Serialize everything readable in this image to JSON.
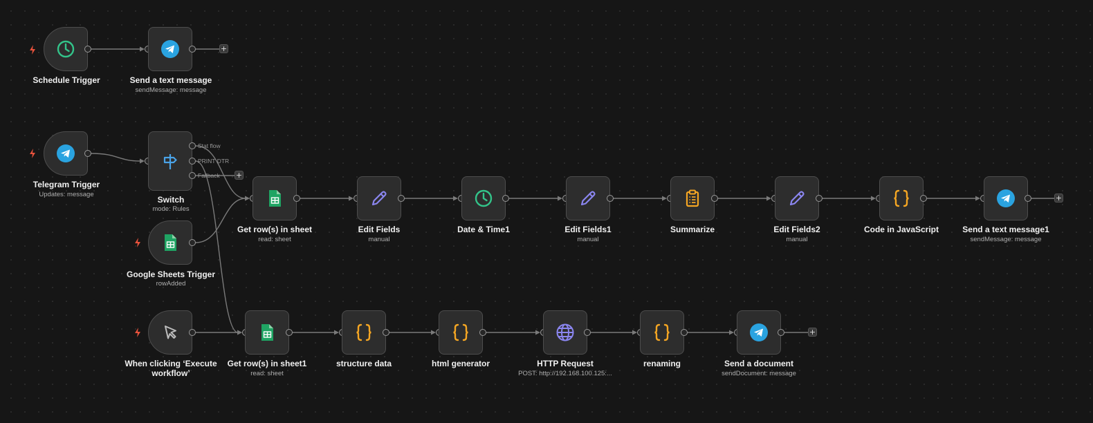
{
  "nodes": [
    {
      "id": "schedule",
      "label": "Schedule Trigger",
      "sub": "",
      "icon": "clock-icon"
    },
    {
      "id": "send1",
      "label": "Send a text message",
      "sub": "sendMessage: message",
      "icon": "telegram-icon"
    },
    {
      "id": "tgtrigger",
      "label": "Telegram Trigger",
      "sub": "Updates: message",
      "icon": "telegram-icon"
    },
    {
      "id": "switch",
      "label": "Switch",
      "sub": "mode: Rules",
      "icon": "signpost-icon"
    },
    {
      "id": "gstrigger",
      "label": "Google Sheets Trigger",
      "sub": "rowAdded",
      "icon": "sheets-icon"
    },
    {
      "id": "getrows",
      "label": "Get row(s) in sheet",
      "sub": "read: sheet",
      "icon": "sheets-icon"
    },
    {
      "id": "edit",
      "label": "Edit Fields",
      "sub": "manual",
      "icon": "pencil-icon"
    },
    {
      "id": "datetime",
      "label": "Date & Time1",
      "sub": "",
      "icon": "clock-icon"
    },
    {
      "id": "edit1",
      "label": "Edit Fields1",
      "sub": "manual",
      "icon": "pencil-icon"
    },
    {
      "id": "summarize",
      "label": "Summarize",
      "sub": "",
      "icon": "clipboard-icon"
    },
    {
      "id": "edit2",
      "label": "Edit Fields2",
      "sub": "manual",
      "icon": "pencil-icon"
    },
    {
      "id": "code",
      "label": "Code in JavaScript",
      "sub": "",
      "icon": "braces-icon"
    },
    {
      "id": "send2",
      "label": "Send a text message1",
      "sub": "sendMessage: message",
      "icon": "telegram-icon"
    },
    {
      "id": "manual",
      "label": "When clicking ‘Execute workflow’",
      "sub": "",
      "icon": "cursor-icon"
    },
    {
      "id": "getrows1",
      "label": "Get row(s) in sheet1",
      "sub": "read: sheet",
      "icon": "sheets-icon"
    },
    {
      "id": "structure",
      "label": "structure data",
      "sub": "",
      "icon": "braces-icon"
    },
    {
      "id": "htmlgen",
      "label": "html generator",
      "sub": "",
      "icon": "braces-icon"
    },
    {
      "id": "http",
      "label": "HTTP Request",
      "sub": "POST: http://192.168.100.125:...",
      "icon": "globe-icon"
    },
    {
      "id": "renaming",
      "label": "renaming",
      "sub": "",
      "icon": "braces-icon"
    },
    {
      "id": "senddoc",
      "label": "Send a document",
      "sub": "sendDocument: message",
      "icon": "telegram-icon"
    }
  ],
  "switch_outputs": [
    "Stat flow",
    "PRINT DTR",
    "Fallback"
  ],
  "plus_symbol": "+",
  "colors": {
    "canvas": "#161616",
    "node": "#2d2d2d",
    "edge": "#7a7a7a",
    "telegram": "#2aa3e0",
    "sheets": "#1fa463",
    "clock": "#33c48a",
    "pencil": "#8b86f0",
    "code": "#f5a623",
    "globe": "#8b86f0",
    "trigger_bolt": "#e8523c"
  }
}
